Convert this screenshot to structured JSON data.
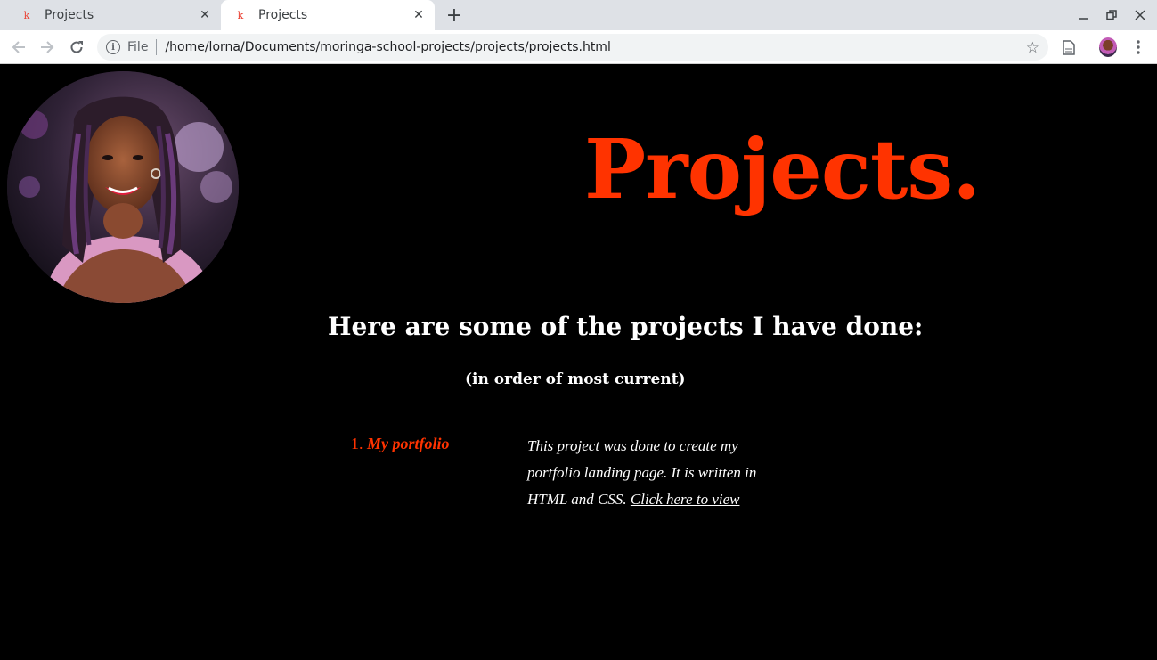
{
  "browser": {
    "tabs": [
      {
        "title": "Projects",
        "active": false
      },
      {
        "title": "Projects",
        "active": true
      }
    ],
    "address": {
      "scheme_label": "File",
      "url": "/home/lorna/Documents/moringa-school-projects/projects/projects.html"
    },
    "icons": {
      "favicon": "k-favicon-icon",
      "back": "arrow-left-icon",
      "forward": "arrow-right-icon",
      "reload": "reload-icon",
      "info": "info-icon",
      "bookmark": "star-icon",
      "page": "document-icon",
      "profile": "profile-avatar-icon",
      "menu": "kebab-menu-icon"
    }
  },
  "page": {
    "headline": "Projects.",
    "subheading": "Here are some of the projects I have done:",
    "note": "(in order of most current)",
    "projects": [
      {
        "number": "1.",
        "title": "My portfolio",
        "description": "This project was done to create my portfolio landing page. It is written in HTML and CSS.",
        "link_text": "Click here to view"
      }
    ],
    "colors": {
      "accent": "#ff3300",
      "background": "#000000",
      "text": "#ffffff"
    }
  }
}
